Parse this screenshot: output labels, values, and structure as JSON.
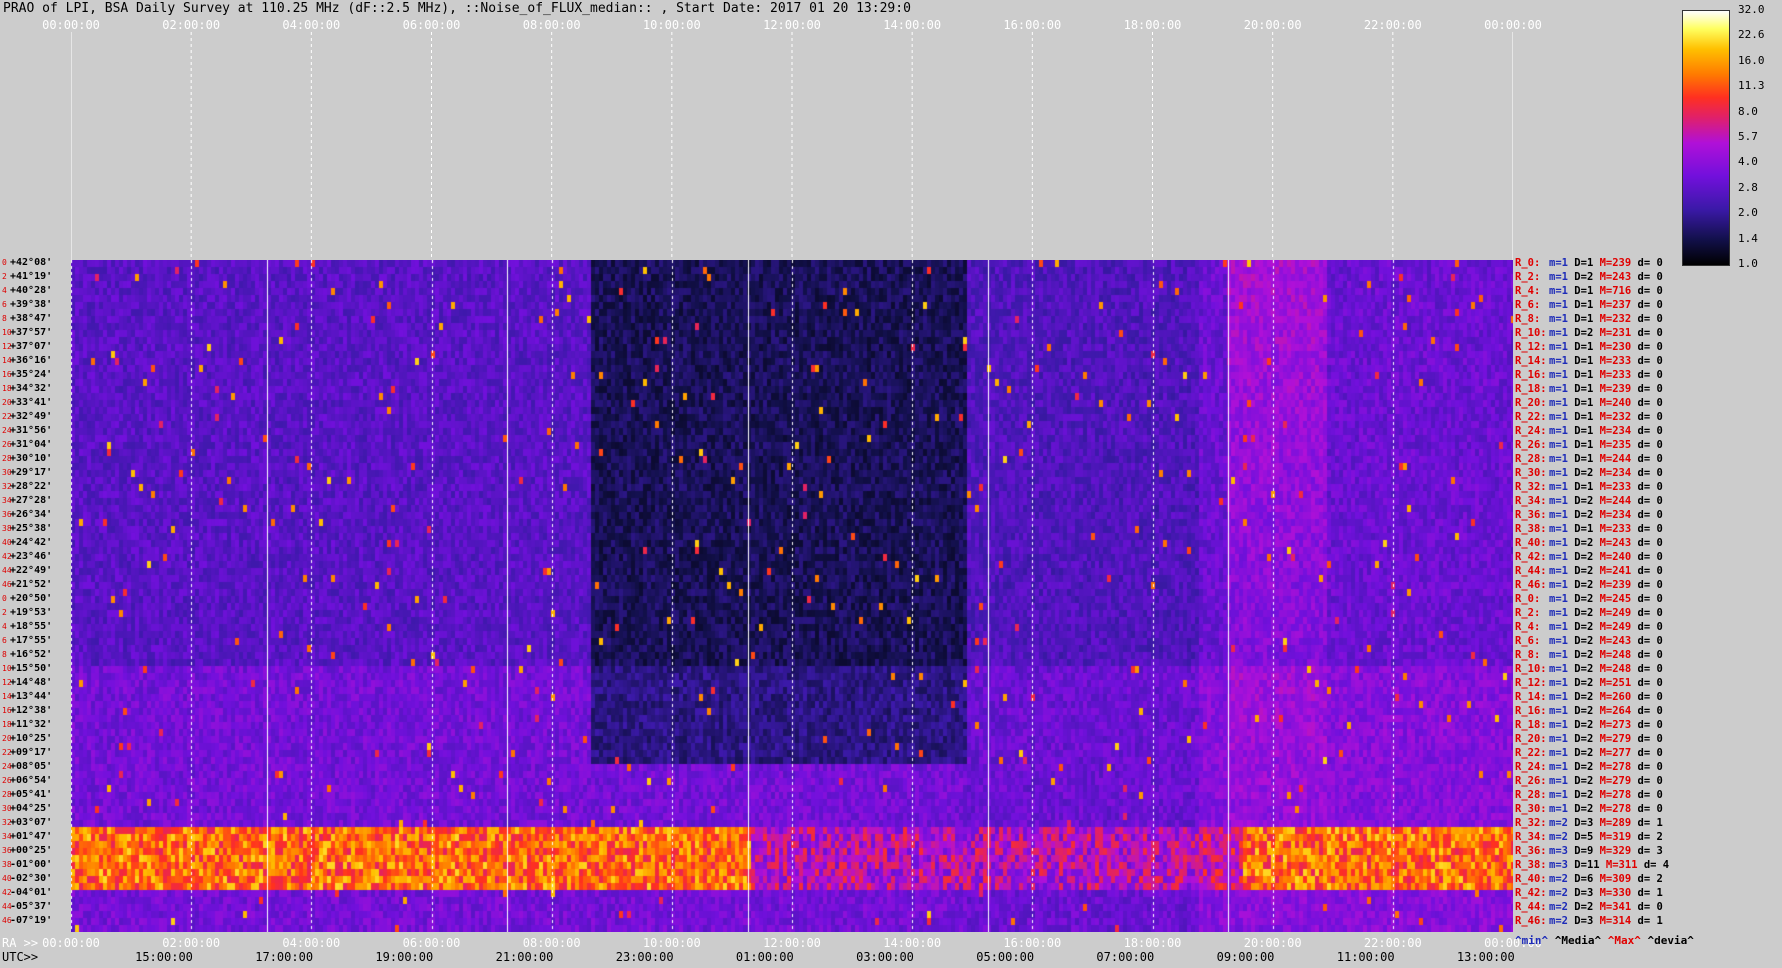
{
  "title": "PRAO of LPI, BSA Daily Survey at 110.25 MHz (dF::2.5 MHz), ::Noise_of_FLUX_median:: , Start Date: 2017 01 20 13:29:0",
  "top_axis": [
    "00:00:00",
    "02:00:00",
    "04:00:00",
    "06:00:00",
    "08:00:00",
    "10:00:00",
    "12:00:00",
    "14:00:00",
    "16:00:00",
    "18:00:00",
    "20:00:00",
    "22:00:00",
    "00:00:00"
  ],
  "ra_label": "RA >>",
  "ra_axis": [
    "00:00:00",
    "02:00:00",
    "04:00:00",
    "06:00:00",
    "08:00:00",
    "10:00:00",
    "12:00:00",
    "14:00:00",
    "16:00:00",
    "18:00:00",
    "20:00:00",
    "22:00:00",
    "00:00:00"
  ],
  "utc_label": "UTC>>",
  "utc_axis": [
    "15:00:00",
    "17:00:00",
    "19:00:00",
    "21:00:00",
    "23:00:00",
    "01:00:00",
    "03:00:00",
    "05:00:00",
    "07:00:00",
    "09:00:00",
    "11:00:00",
    "13:00:00"
  ],
  "declinations": [
    "+42°08'",
    "+41°19'",
    "+40°28'",
    "+39°38'",
    "+38°47'",
    "+37°57'",
    "+37°07'",
    "+36°16'",
    "+35°24'",
    "+34°32'",
    "+33°41'",
    "+32°49'",
    "+31°56'",
    "+31°04'",
    "+30°10'",
    "+29°17'",
    "+28°22'",
    "+27°28'",
    "+26°34'",
    "+25°38'",
    "+24°42'",
    "+23°46'",
    "+22°49'",
    "+21°52'",
    "+20°50'",
    "+19°53'",
    "+18°55'",
    "+17°55'",
    "+16°52'",
    "+15°50'",
    "+14°48'",
    "+13°44'",
    "+12°38'",
    "+11°32'",
    "+10°25'",
    "+09°17'",
    "+08°05'",
    "+06°54'",
    "+05°41'",
    "+04°25'",
    "+03°07'",
    "+01°47'",
    "+00°25'",
    "-01°00'",
    "-02°30'",
    "-04°01'",
    "-05°37'",
    "-07°19'"
  ],
  "row_numbers": [
    "0",
    "2",
    "4",
    "6",
    "8",
    "10",
    "12",
    "14",
    "16",
    "18",
    "20",
    "22",
    "24",
    "26",
    "28",
    "30",
    "32",
    "34",
    "36",
    "38",
    "40",
    "42",
    "44",
    "46",
    "0",
    "2",
    "4",
    "6",
    "8",
    "10",
    "12",
    "14",
    "16",
    "18",
    "20",
    "22",
    "24",
    "26",
    "28",
    "30",
    "32",
    "34",
    "36",
    "38",
    "40",
    "42",
    "44",
    "46"
  ],
  "stats": [
    {
      "r": "R_0:",
      "m": "m=1",
      "d": "D=1",
      "x": "M=239",
      "dv": "d= 0"
    },
    {
      "r": "R_2:",
      "m": "m=1",
      "d": "D=2",
      "x": "M=243",
      "dv": "d= 0"
    },
    {
      "r": "R_4:",
      "m": "m=1",
      "d": "D=1",
      "x": "M=716",
      "dv": "d= 0"
    },
    {
      "r": "R_6:",
      "m": "m=1",
      "d": "D=1",
      "x": "M=237",
      "dv": "d= 0"
    },
    {
      "r": "R_8:",
      "m": "m=1",
      "d": "D=1",
      "x": "M=232",
      "dv": "d= 0"
    },
    {
      "r": "R_10:",
      "m": "m=1",
      "d": "D=2",
      "x": "M=231",
      "dv": "d= 0"
    },
    {
      "r": "R_12:",
      "m": "m=1",
      "d": "D=1",
      "x": "M=230",
      "dv": "d= 0"
    },
    {
      "r": "R_14:",
      "m": "m=1",
      "d": "D=1",
      "x": "M=233",
      "dv": "d= 0"
    },
    {
      "r": "R_16:",
      "m": "m=1",
      "d": "D=1",
      "x": "M=233",
      "dv": "d= 0"
    },
    {
      "r": "R_18:",
      "m": "m=1",
      "d": "D=1",
      "x": "M=239",
      "dv": "d= 0"
    },
    {
      "r": "R_20:",
      "m": "m=1",
      "d": "D=1",
      "x": "M=240",
      "dv": "d= 0"
    },
    {
      "r": "R_22:",
      "m": "m=1",
      "d": "D=1",
      "x": "M=232",
      "dv": "d= 0"
    },
    {
      "r": "R_24:",
      "m": "m=1",
      "d": "D=1",
      "x": "M=234",
      "dv": "d= 0"
    },
    {
      "r": "R_26:",
      "m": "m=1",
      "d": "D=1",
      "x": "M=235",
      "dv": "d= 0"
    },
    {
      "r": "R_28:",
      "m": "m=1",
      "d": "D=1",
      "x": "M=244",
      "dv": "d= 0"
    },
    {
      "r": "R_30:",
      "m": "m=1",
      "d": "D=2",
      "x": "M=234",
      "dv": "d= 0"
    },
    {
      "r": "R_32:",
      "m": "m=1",
      "d": "D=1",
      "x": "M=233",
      "dv": "d= 0"
    },
    {
      "r": "R_34:",
      "m": "m=1",
      "d": "D=2",
      "x": "M=244",
      "dv": "d= 0"
    },
    {
      "r": "R_36:",
      "m": "m=1",
      "d": "D=2",
      "x": "M=234",
      "dv": "d= 0"
    },
    {
      "r": "R_38:",
      "m": "m=1",
      "d": "D=1",
      "x": "M=233",
      "dv": "d= 0"
    },
    {
      "r": "R_40:",
      "m": "m=1",
      "d": "D=2",
      "x": "M=243",
      "dv": "d= 0"
    },
    {
      "r": "R_42:",
      "m": "m=1",
      "d": "D=2",
      "x": "M=240",
      "dv": "d= 0"
    },
    {
      "r": "R_44:",
      "m": "m=1",
      "d": "D=2",
      "x": "M=241",
      "dv": "d= 0"
    },
    {
      "r": "R_46:",
      "m": "m=1",
      "d": "D=2",
      "x": "M=239",
      "dv": "d= 0"
    },
    {
      "r": "R_0:",
      "m": "m=1",
      "d": "D=2",
      "x": "M=245",
      "dv": "d= 0"
    },
    {
      "r": "R_2:",
      "m": "m=1",
      "d": "D=2",
      "x": "M=249",
      "dv": "d= 0"
    },
    {
      "r": "R_4:",
      "m": "m=1",
      "d": "D=2",
      "x": "M=249",
      "dv": "d= 0"
    },
    {
      "r": "R_6:",
      "m": "m=1",
      "d": "D=2",
      "x": "M=243",
      "dv": "d= 0"
    },
    {
      "r": "R_8:",
      "m": "m=1",
      "d": "D=2",
      "x": "M=248",
      "dv": "d= 0"
    },
    {
      "r": "R_10:",
      "m": "m=1",
      "d": "D=2",
      "x": "M=248",
      "dv": "d= 0"
    },
    {
      "r": "R_12:",
      "m": "m=1",
      "d": "D=2",
      "x": "M=251",
      "dv": "d= 0"
    },
    {
      "r": "R_14:",
      "m": "m=1",
      "d": "D=2",
      "x": "M=260",
      "dv": "d= 0"
    },
    {
      "r": "R_16:",
      "m": "m=1",
      "d": "D=2",
      "x": "M=264",
      "dv": "d= 0"
    },
    {
      "r": "R_18:",
      "m": "m=1",
      "d": "D=2",
      "x": "M=273",
      "dv": "d= 0"
    },
    {
      "r": "R_20:",
      "m": "m=1",
      "d": "D=2",
      "x": "M=279",
      "dv": "d= 0"
    },
    {
      "r": "R_22:",
      "m": "m=1",
      "d": "D=2",
      "x": "M=277",
      "dv": "d= 0"
    },
    {
      "r": "R_24:",
      "m": "m=1",
      "d": "D=2",
      "x": "M=278",
      "dv": "d= 0"
    },
    {
      "r": "R_26:",
      "m": "m=1",
      "d": "D=2",
      "x": "M=279",
      "dv": "d= 0"
    },
    {
      "r": "R_28:",
      "m": "m=1",
      "d": "D=2",
      "x": "M=278",
      "dv": "d= 0"
    },
    {
      "r": "R_30:",
      "m": "m=1",
      "d": "D=2",
      "x": "M=278",
      "dv": "d= 0"
    },
    {
      "r": "R_32:",
      "m": "m=2",
      "d": "D=3",
      "x": "M=289",
      "dv": "d= 1"
    },
    {
      "r": "R_34:",
      "m": "m=2",
      "d": "D=5",
      "x": "M=319",
      "dv": "d= 2"
    },
    {
      "r": "R_36:",
      "m": "m=3",
      "d": "D=9",
      "x": "M=329",
      "dv": "d= 3"
    },
    {
      "r": "R_38:",
      "m": "m=3",
      "d": "D=11",
      "x": "M=311",
      "dv": "d= 4"
    },
    {
      "r": "R_40:",
      "m": "m=2",
      "d": "D=6",
      "x": "M=309",
      "dv": "d= 2"
    },
    {
      "r": "R_42:",
      "m": "m=2",
      "d": "D=3",
      "x": "M=330",
      "dv": "d= 1"
    },
    {
      "r": "R_44:",
      "m": "m=2",
      "d": "D=2",
      "x": "M=341",
      "dv": "d= 0"
    },
    {
      "r": "R_46:",
      "m": "m=2",
      "d": "D=3",
      "x": "M=314",
      "dv": "d= 1"
    }
  ],
  "legend": {
    "min": "^min^",
    "median": "^Media^",
    "max": "^Max^",
    "devia": "^devia^"
  },
  "colorbar_ticks": [
    "32.0",
    "22.6",
    "16.0",
    "11.3",
    "8.0",
    "5.7",
    "4.0",
    "2.8",
    "2.0",
    "1.4",
    "1.0"
  ],
  "colors": {
    "background": "#cccccc",
    "grid": "#ffffff",
    "stat_red": "#e00000",
    "stat_blue": "#1d2bb8"
  }
}
